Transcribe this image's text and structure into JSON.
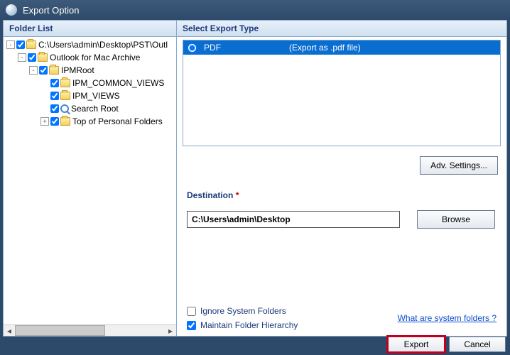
{
  "window": {
    "title": "Export Option"
  },
  "left": {
    "header": "Folder List",
    "tree": [
      {
        "level": 0,
        "expander": "-",
        "checked": true,
        "icon": "folder",
        "label": "C:\\Users\\admin\\Desktop\\PST\\Outl"
      },
      {
        "level": 1,
        "expander": "-",
        "checked": true,
        "icon": "folder",
        "label": "Outlook for Mac Archive"
      },
      {
        "level": 2,
        "expander": "-",
        "checked": true,
        "icon": "folder",
        "label": "IPMRoot"
      },
      {
        "level": 3,
        "expander": "",
        "checked": true,
        "icon": "folder",
        "label": "IPM_COMMON_VIEWS"
      },
      {
        "level": 3,
        "expander": "",
        "checked": true,
        "icon": "folder",
        "label": "IPM_VIEWS"
      },
      {
        "level": 3,
        "expander": "",
        "checked": true,
        "icon": "search",
        "label": "Search Root"
      },
      {
        "level": 3,
        "expander": "+",
        "checked": true,
        "icon": "folder",
        "label": "Top of Personal Folders"
      }
    ]
  },
  "right": {
    "header": "Select Export Type",
    "types": [
      {
        "selected": true,
        "name": "PDF",
        "desc": "(Export as .pdf file)"
      }
    ],
    "adv_settings": "Adv. Settings...",
    "destination_label": "Destination",
    "destination_value": "C:\\Users\\admin\\Desktop",
    "browse": "Browse",
    "ignore_label": "Ignore System Folders",
    "ignore_checked": false,
    "maintain_label": "Maintain Folder Hierarchy",
    "maintain_checked": true,
    "link_text": "What are system folders ?"
  },
  "footer": {
    "export": "Export",
    "cancel": "Cancel"
  }
}
